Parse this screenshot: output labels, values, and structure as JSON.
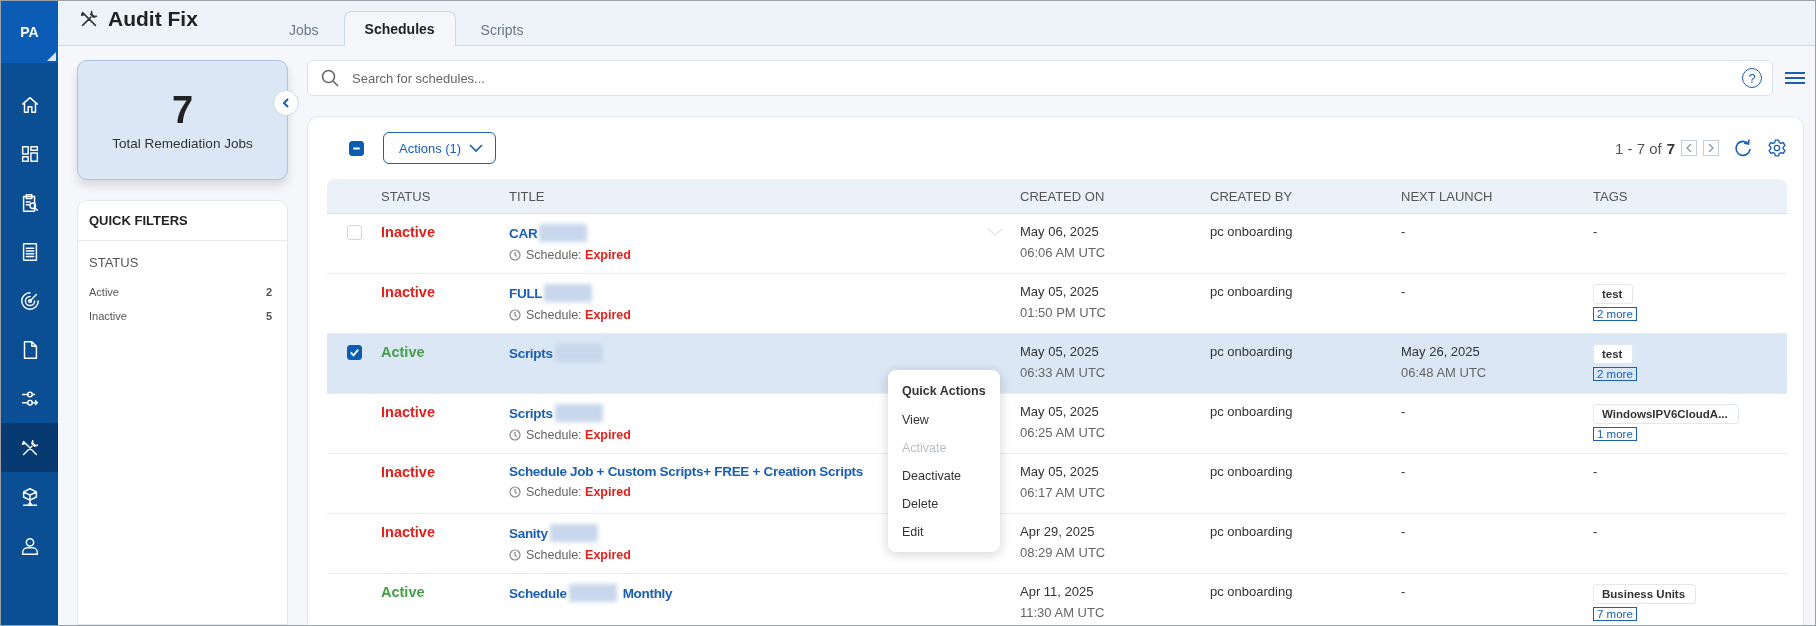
{
  "nav": {
    "avatar": "PA",
    "items": [
      {
        "selected": false
      },
      {
        "selected": false
      },
      {
        "selected": false
      },
      {
        "selected": false
      },
      {
        "selected": false
      },
      {
        "selected": false
      },
      {
        "selected": false
      },
      {
        "selected": true
      },
      {
        "selected": false
      },
      {
        "selected": false
      }
    ]
  },
  "app": {
    "title": "Audit Fix"
  },
  "tabs": [
    {
      "label": "Jobs",
      "selected": false
    },
    {
      "label": "Schedules",
      "selected": true
    },
    {
      "label": "Scripts",
      "selected": false
    }
  ],
  "summary": {
    "count": "7",
    "label": "Total Remediation Jobs"
  },
  "quick_filters": {
    "title": "QUICK FILTERS",
    "groups": [
      {
        "title": "STATUS",
        "items": [
          {
            "label": "Active",
            "count": "2"
          },
          {
            "label": "Inactive",
            "count": "5"
          }
        ]
      }
    ]
  },
  "search": {
    "placeholder": "Search for schedules...",
    "help": "?"
  },
  "toolbar": {
    "select_all": {
      "checked": true,
      "indeterminate": true
    },
    "actions_label": "Actions (1)",
    "range": "1 - 7 of",
    "total": "7"
  },
  "table": {
    "columns": [
      "STATUS",
      "TITLE",
      "CREATED ON",
      "CREATED BY",
      "NEXT LAUNCH",
      "TAGS"
    ],
    "rows": [
      {
        "selected": false,
        "hovered": true,
        "status": "Inactive",
        "title": [
          {
            "kind": "text",
            "text": "CAR"
          },
          {
            "kind": "redacted"
          }
        ],
        "schedule": {
          "label": "Schedule:",
          "value": "Expired"
        },
        "created_on": [
          "May 06, 2025",
          "06:06 AM UTC"
        ],
        "created_by": "pc onboarding",
        "next_launch": [
          "-"
        ],
        "tags": {
          "kind": "none",
          "text": "-"
        }
      },
      {
        "selected": false,
        "status": "Inactive",
        "title": [
          {
            "kind": "text",
            "text": "FULL"
          },
          {
            "kind": "redacted"
          }
        ],
        "schedule": {
          "label": "Schedule:",
          "value": "Expired"
        },
        "created_on": [
          "May 05, 2025",
          "01:50 PM UTC"
        ],
        "created_by": "pc onboarding",
        "next_launch": [
          "-"
        ],
        "tags": {
          "kind": "chip",
          "text": "test",
          "more": "2 more"
        }
      },
      {
        "selected": true,
        "status": "Active",
        "title": [
          {
            "kind": "text",
            "text": "Scripts"
          },
          {
            "kind": "redacted"
          }
        ],
        "created_on": [
          "May 05, 2025",
          "06:33 AM UTC"
        ],
        "created_by": "pc onboarding",
        "next_launch": [
          "May 26, 2025",
          "06:48 AM UTC"
        ],
        "tags": {
          "kind": "chip",
          "text": "test",
          "more": "2 more"
        }
      },
      {
        "selected": false,
        "status": "Inactive",
        "title": [
          {
            "kind": "text",
            "text": "Scripts"
          },
          {
            "kind": "redacted"
          }
        ],
        "schedule": {
          "label": "Schedule:",
          "value": "Expired"
        },
        "created_on": [
          "May 05, 2025",
          "06:25 AM UTC"
        ],
        "created_by": "pc onboarding",
        "next_launch": [
          "-"
        ],
        "tags": {
          "kind": "chip",
          "text": "WindowsIPV6CloudA...",
          "more": "1 more"
        }
      },
      {
        "selected": false,
        "status": "Inactive",
        "title": [
          {
            "kind": "text",
            "text": "Schedule Job + Custom Scripts+ FREE + Creation Scripts"
          }
        ],
        "schedule": {
          "label": "Schedule:",
          "value": "Expired"
        },
        "created_on": [
          "May 05, 2025",
          "06:17 AM UTC"
        ],
        "created_by": "pc onboarding",
        "next_launch": [
          "-"
        ],
        "tags": {
          "kind": "none",
          "text": "-"
        }
      },
      {
        "selected": false,
        "status": "Inactive",
        "title": [
          {
            "kind": "text",
            "text": "Sanity"
          },
          {
            "kind": "redacted"
          }
        ],
        "schedule": {
          "label": "Schedule:",
          "value": "Expired"
        },
        "created_on": [
          "Apr 29, 2025",
          "08:29 AM UTC"
        ],
        "created_by": "pc onboarding",
        "next_launch": [
          "-"
        ],
        "tags": {
          "kind": "none",
          "text": "-"
        }
      },
      {
        "selected": false,
        "status": "Active",
        "title": [
          {
            "kind": "text",
            "text": "Schedule"
          },
          {
            "kind": "redacted"
          },
          {
            "kind": "text",
            "text": "Monthly"
          }
        ],
        "created_on": [
          "Apr 11, 2025",
          "11:30 AM UTC"
        ],
        "created_by": "pc onboarding",
        "next_launch": [
          "-"
        ],
        "tags": {
          "kind": "chip",
          "text": "Business Units",
          "more": "7 more"
        }
      }
    ]
  },
  "context_menu": {
    "title": "Quick Actions",
    "items": [
      {
        "label": "View",
        "disabled": false
      },
      {
        "label": "Activate",
        "disabled": true
      },
      {
        "label": "Deactivate",
        "disabled": false
      },
      {
        "label": "Delete",
        "disabled": false
      },
      {
        "label": "Edit",
        "disabled": false
      }
    ]
  }
}
